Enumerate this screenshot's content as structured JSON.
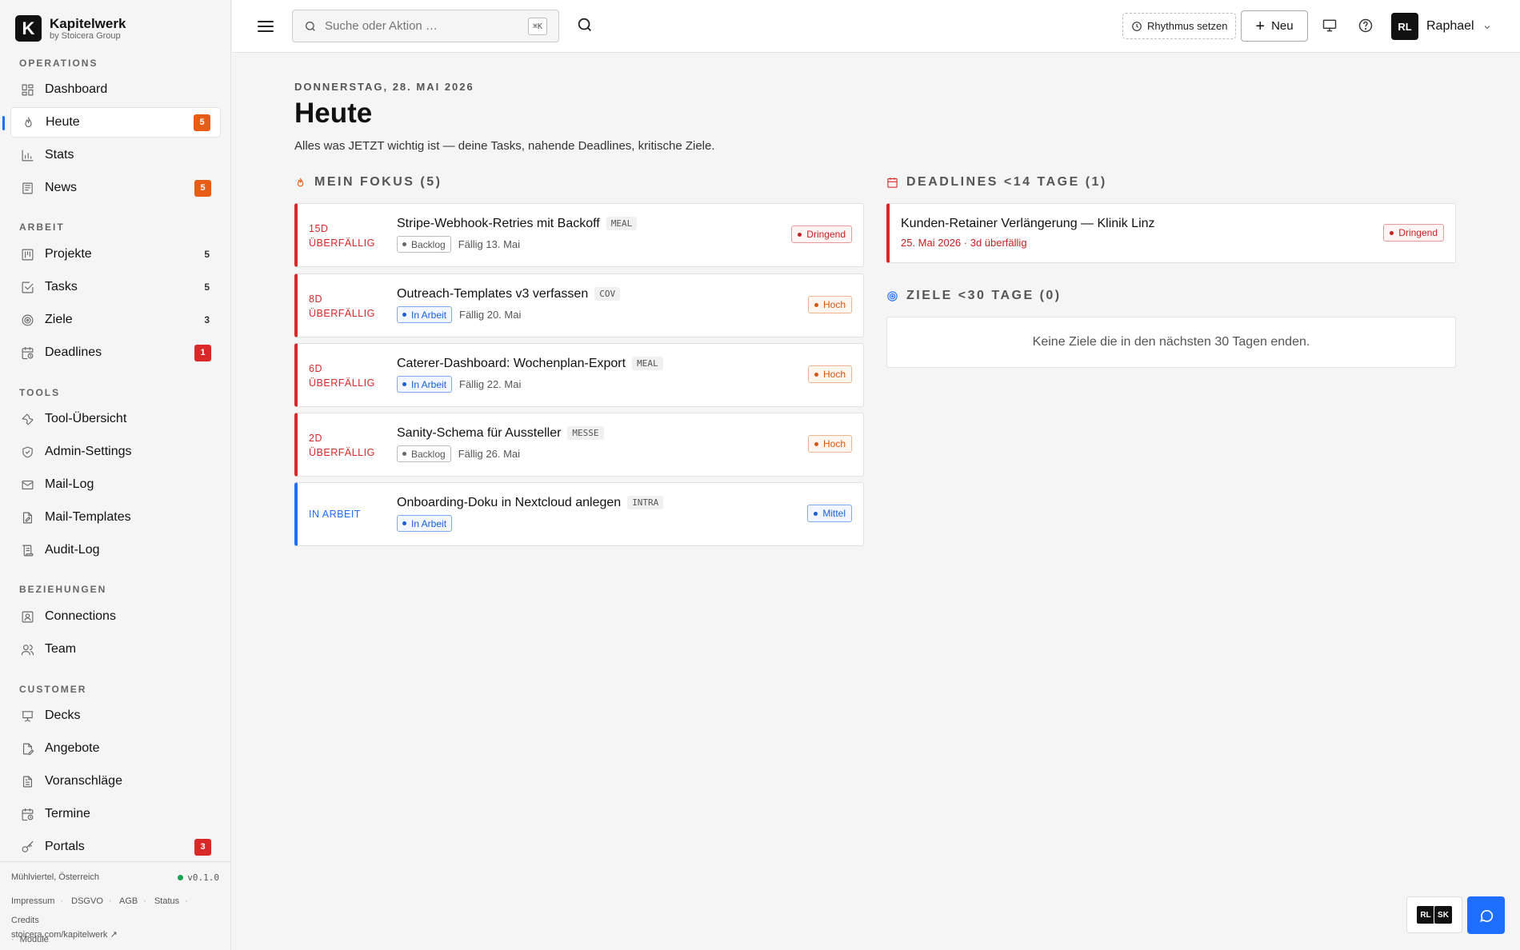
{
  "brand": {
    "logo_letter": "K",
    "name": "Kapitelwerk",
    "sub": "by Stoicera Group"
  },
  "sidebar": {
    "sections": {
      "operations": "OPERATIONS",
      "arbeit": "ARBEIT",
      "tools": "TOOLS",
      "beziehungen": "BEZIEHUNGEN",
      "customer": "CUSTOMER"
    },
    "items": {
      "dashboard": {
        "label": "Dashboard",
        "icon": "grid-icon"
      },
      "heute": {
        "label": "Heute",
        "icon": "flame-icon",
        "badge": "5"
      },
      "stats": {
        "label": "Stats",
        "icon": "bar-chart-icon"
      },
      "news": {
        "label": "News",
        "icon": "newspaper-icon",
        "badge": "5"
      },
      "projekte": {
        "label": "Projekte",
        "icon": "kanban-icon",
        "count": "5"
      },
      "tasks": {
        "label": "Tasks",
        "icon": "check-square-icon",
        "count": "5"
      },
      "ziele": {
        "label": "Ziele",
        "icon": "target-icon",
        "count": "3"
      },
      "deadlines": {
        "label": "Deadlines",
        "icon": "calendar-clock-icon",
        "badge": "1"
      },
      "tool_uebersicht": {
        "label": "Tool-Übersicht",
        "icon": "wrench-icon"
      },
      "admin_settings": {
        "label": "Admin-Settings",
        "icon": "shield-icon"
      },
      "mail_log": {
        "label": "Mail-Log",
        "icon": "mail-icon"
      },
      "mail_templates": {
        "label": "Mail-Templates",
        "icon": "file-edit-icon"
      },
      "audit_log": {
        "label": "Audit-Log",
        "icon": "scroll-icon"
      },
      "connections": {
        "label": "Connections",
        "icon": "contact-icon"
      },
      "team": {
        "label": "Team",
        "icon": "users-icon"
      },
      "decks": {
        "label": "Decks",
        "icon": "presentation-icon"
      },
      "angebote": {
        "label": "Angebote",
        "icon": "file-pen-icon"
      },
      "voranschlaege": {
        "label": "Voranschläge",
        "icon": "file-text-icon"
      },
      "termine": {
        "label": "Termine",
        "icon": "calendar-clock-icon"
      },
      "portals": {
        "label": "Portals",
        "icon": "key-icon",
        "badge": "3"
      }
    },
    "footer": {
      "location": "Mühlviertel, Österreich",
      "version": "v0.1.0",
      "links": [
        "Impressum",
        "DSGVO",
        "AGB",
        "Status",
        "Credits",
        "Module"
      ],
      "url": "stoicera.com/kapitelwerk ↗"
    }
  },
  "topbar": {
    "search_placeholder": "Suche oder Aktion …",
    "shortcut": "⌘K",
    "rhythm_label": "Rhythmus setzen",
    "new_label": "Neu",
    "user_initials": "RL",
    "user_name": "Raphael"
  },
  "main": {
    "date": "DONNERSTAG, 28. MAI 2026",
    "title": "Heute",
    "subtitle": "Alles was JETZT wichtig ist — deine Tasks, nahende Deadlines, kritische Ziele.",
    "focus_heading": "MEIN FOKUS (5)",
    "tasks": [
      {
        "status_line1": "15D",
        "status_line2": "ÜBERFÄLLIG",
        "title": "Stripe-Webhook-Retries mit Backoff",
        "tag": "MEAL",
        "state": "Backlog",
        "due": "Fällig 13. Mai",
        "priority": "Dringend"
      },
      {
        "status_line1": "8D",
        "status_line2": "ÜBERFÄLLIG",
        "title": "Outreach-Templates v3 verfassen",
        "tag": "COV",
        "state": "In Arbeit",
        "due": "Fällig 20. Mai",
        "priority": "Hoch"
      },
      {
        "status_line1": "6D",
        "status_line2": "ÜBERFÄLLIG",
        "title": "Caterer-Dashboard: Wochenplan-Export",
        "tag": "MEAL",
        "state": "In Arbeit",
        "due": "Fällig 22. Mai",
        "priority": "Hoch"
      },
      {
        "status_line1": "2D",
        "status_line2": "ÜBERFÄLLIG",
        "title": "Sanity-Schema für Aussteller",
        "tag": "MESSE",
        "state": "Backlog",
        "due": "Fällig 26. Mai",
        "priority": "Hoch"
      },
      {
        "status_line1": "IN ARBEIT",
        "status_line2": "",
        "title": "Onboarding-Doku in Nextcloud anlegen",
        "tag": "INTRA",
        "state": "In Arbeit",
        "due": "",
        "priority": "Mittel"
      }
    ],
    "deadlines_heading": "DEADLINES <14 TAGE (1)",
    "deadline": {
      "title": "Kunden-Retainer Verlängerung — Klinik Linz",
      "sub": "25. Mai 2026 · 3d überfällig",
      "priority": "Dringend"
    },
    "goals_heading": "ZIELE <30 TAGE (0)",
    "goals_empty": "Keine Ziele die in den nächsten 30 Tagen enden."
  },
  "floating": {
    "avatar1": "RL",
    "avatar2": "SK",
    "chat_icon": "chat-bubble-icon"
  },
  "colors": {
    "accent": "#1f6fff",
    "danger": "#d92828",
    "warning": "#e85d16"
  }
}
